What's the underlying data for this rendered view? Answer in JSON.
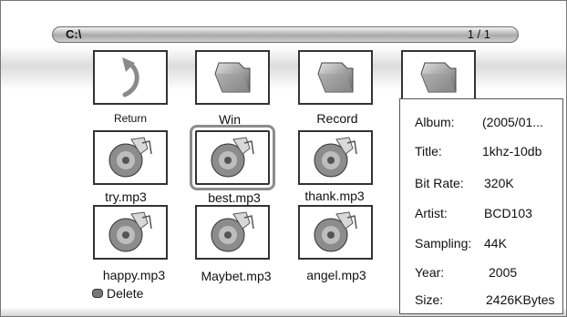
{
  "path_bar": {
    "path": "C:\\",
    "page": "1 / 1"
  },
  "files": [
    {
      "label": "Return",
      "icon": "return-arrow-icon",
      "kind": "return"
    },
    {
      "label": "Win",
      "icon": "folder-icon",
      "kind": "folder"
    },
    {
      "label": "Record",
      "icon": "folder-icon",
      "kind": "folder"
    },
    {
      "label": "",
      "icon": "folder-icon",
      "kind": "folder"
    },
    {
      "label": "try.mp3",
      "icon": "music-file-icon",
      "kind": "music"
    },
    {
      "label": "best.mp3",
      "icon": "music-file-icon",
      "kind": "music",
      "selected": true
    },
    {
      "label": "thank.mp3",
      "icon": "music-file-icon",
      "kind": "music"
    },
    {
      "label": "happy.mp3",
      "icon": "music-file-icon",
      "kind": "music"
    },
    {
      "label": "Maybet.mp3",
      "icon": "music-file-icon",
      "kind": "music"
    },
    {
      "label": "angel.mp3",
      "icon": "music-file-icon",
      "kind": "music"
    }
  ],
  "delete_label": "Delete",
  "info": {
    "album": {
      "label": "Album:",
      "value": "(2005/01..."
    },
    "title": {
      "label": "Title:",
      "value": "1khz-10db"
    },
    "bitrate": {
      "label": "Bit Rate:",
      "value": "320K"
    },
    "artist": {
      "label": "Artist:",
      "value": "BCD103"
    },
    "sampling": {
      "label": "Sampling:",
      "value": "44K"
    },
    "year": {
      "label": "Year:",
      "value": "2005"
    },
    "size": {
      "label": "Size:",
      "value": "2426KBytes"
    }
  }
}
